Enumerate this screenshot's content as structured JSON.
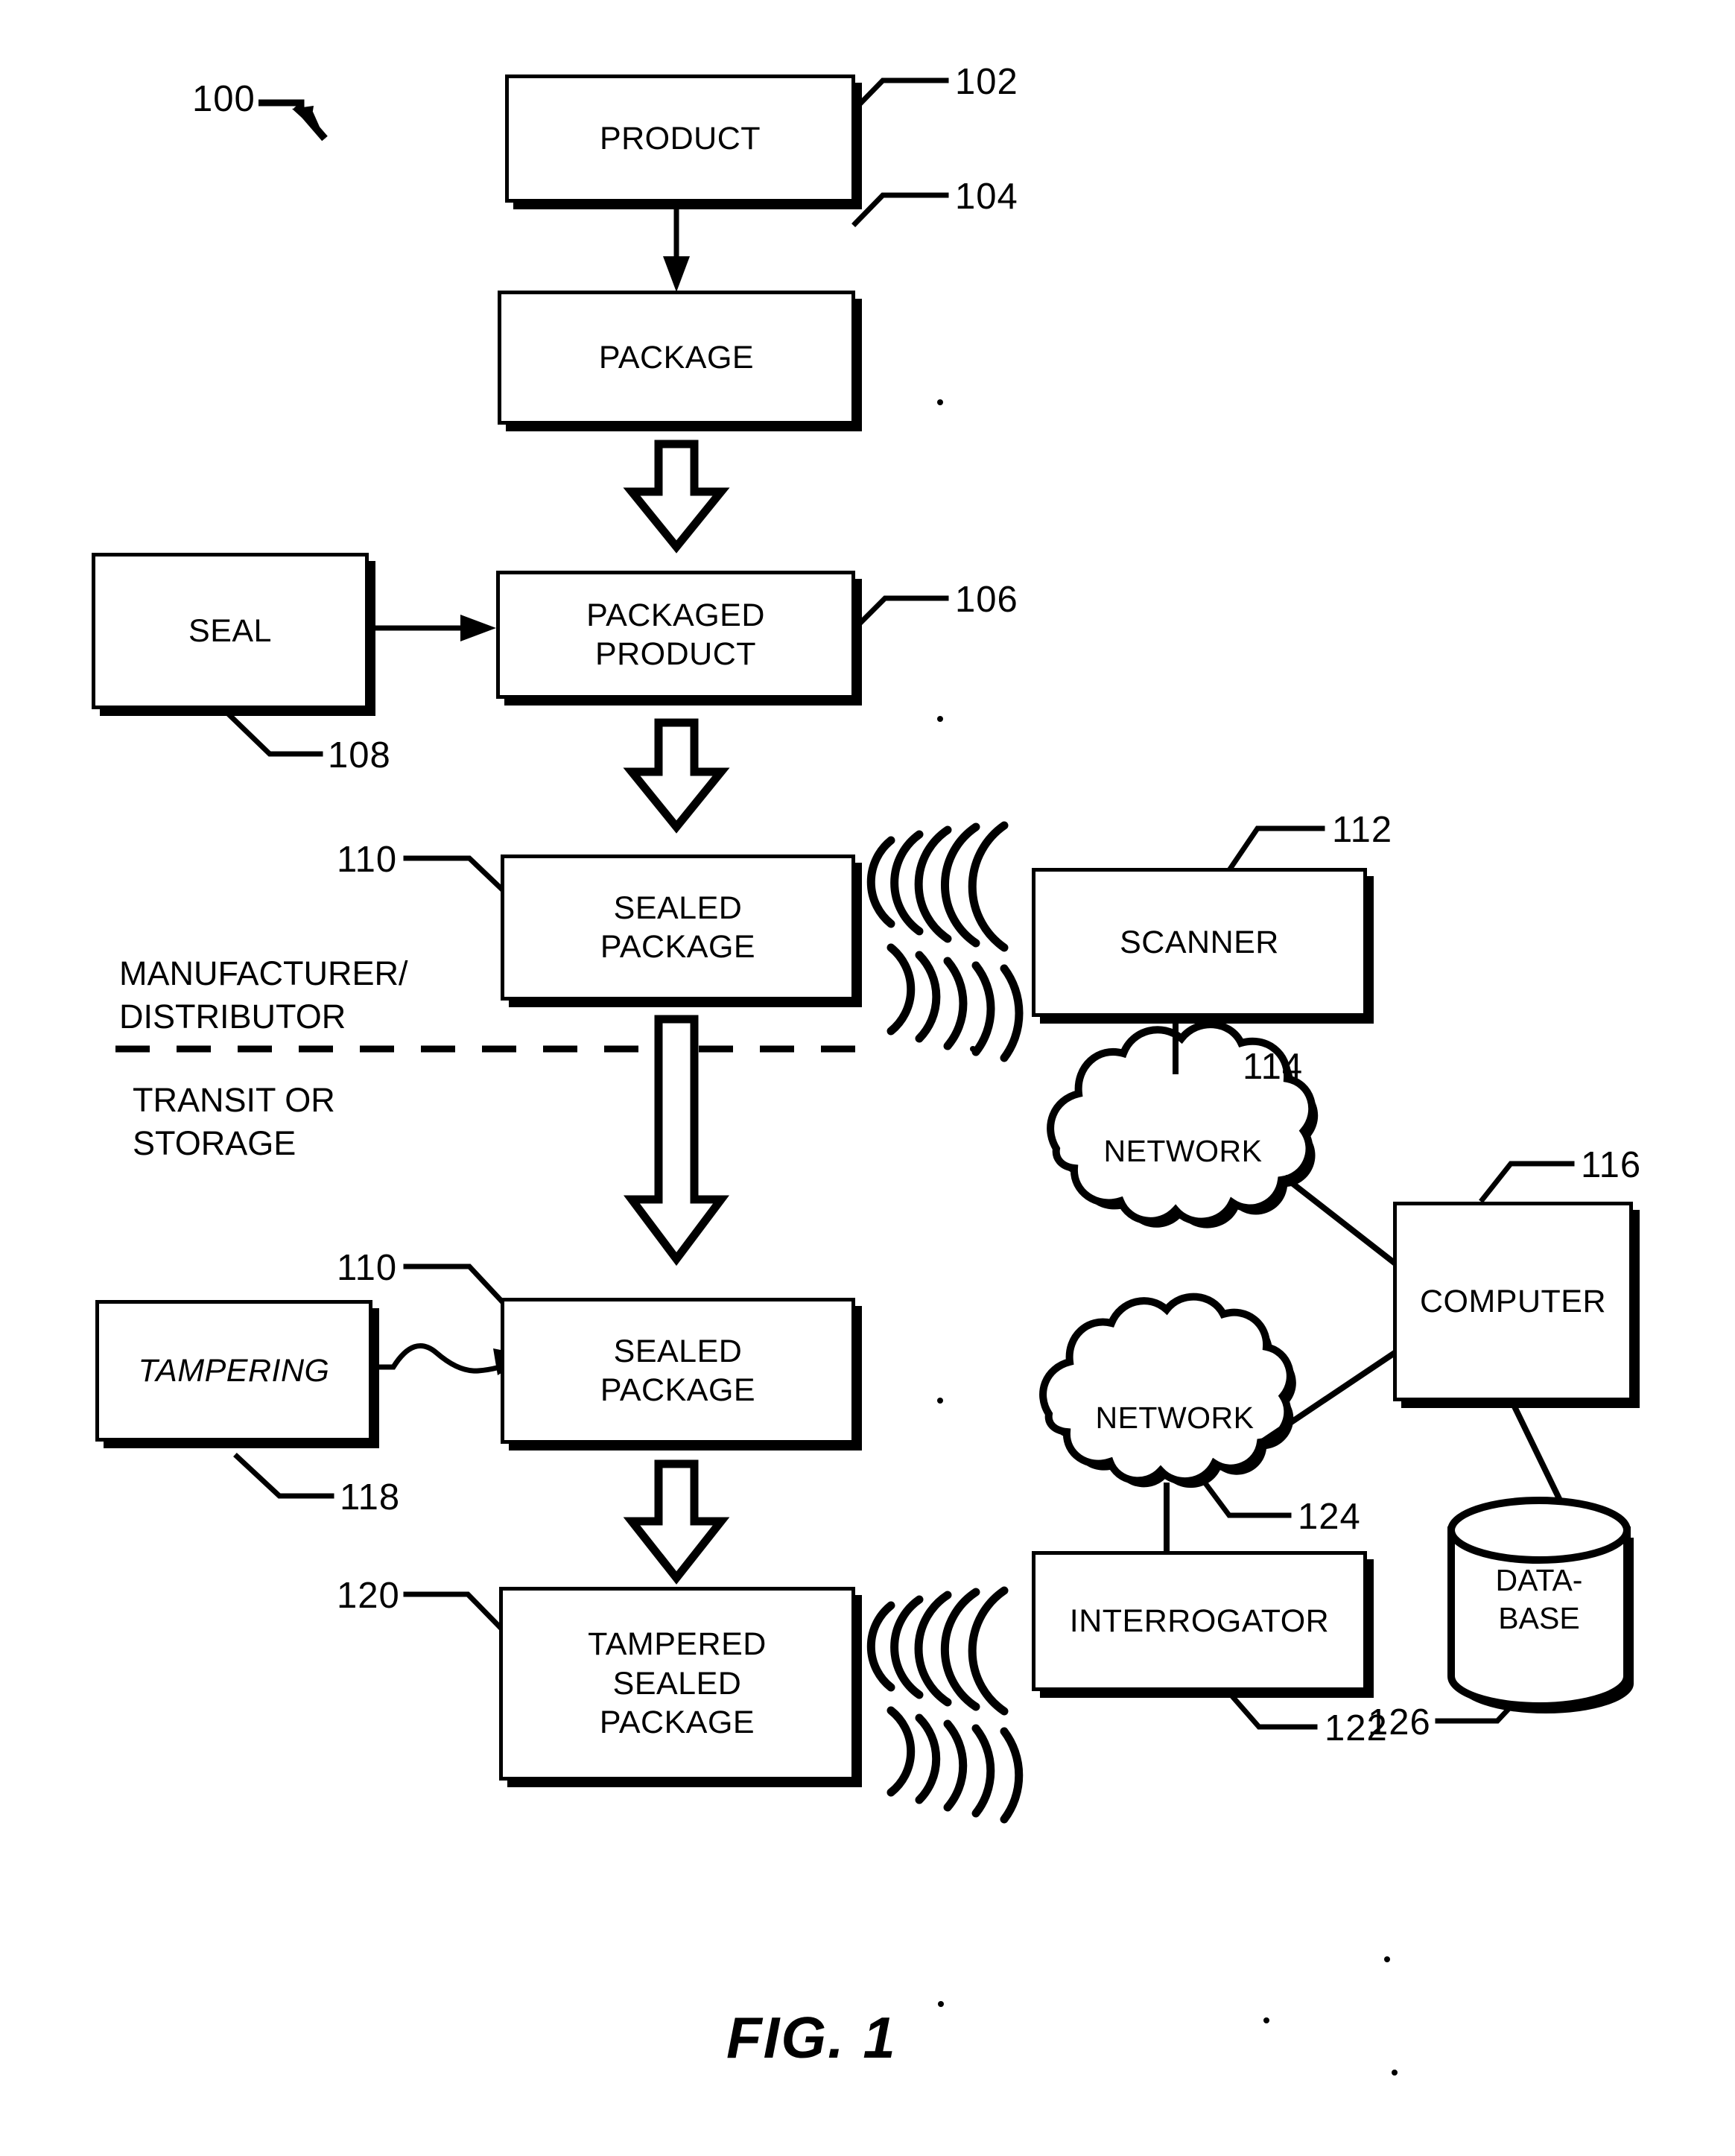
{
  "figure": {
    "caption": "FIG. 1",
    "system_numeral": "100"
  },
  "sections": {
    "upper": "MANUFACTURER/\nDISTRIBUTOR",
    "lower": "TRANSIT OR\nSTORAGE"
  },
  "nodes": {
    "product": {
      "label": "PRODUCT",
      "ref": "102"
    },
    "package": {
      "label": "PACKAGE",
      "ref": "104"
    },
    "seal": {
      "label": "SEAL",
      "ref": "108"
    },
    "packaged_product": {
      "label": "PACKAGED\nPRODUCT",
      "ref": "106"
    },
    "sealed_package_1": {
      "label": "SEALED\nPACKAGE",
      "ref": "110"
    },
    "scanner": {
      "label": "SCANNER",
      "ref": "112"
    },
    "network_top": {
      "label": "NETWORK",
      "ref": "114"
    },
    "computer": {
      "label": "COMPUTER",
      "ref": "116"
    },
    "tampering": {
      "label": "TAMPERING",
      "ref": "118"
    },
    "sealed_package_2": {
      "label": "SEALED\nPACKAGE",
      "ref": "110"
    },
    "network_bottom": {
      "label": "NETWORK",
      "ref": "124"
    },
    "database": {
      "label": "DATA-\nBASE",
      "ref": "126"
    },
    "tampered_sealed_package": {
      "label": "TAMPERED\nSEALED\nPACKAGE",
      "ref": "120"
    },
    "interrogator": {
      "label": "INTERROGATOR",
      "ref": "122"
    }
  },
  "colors": {
    "ink": "#000000",
    "paper": "#ffffff"
  }
}
